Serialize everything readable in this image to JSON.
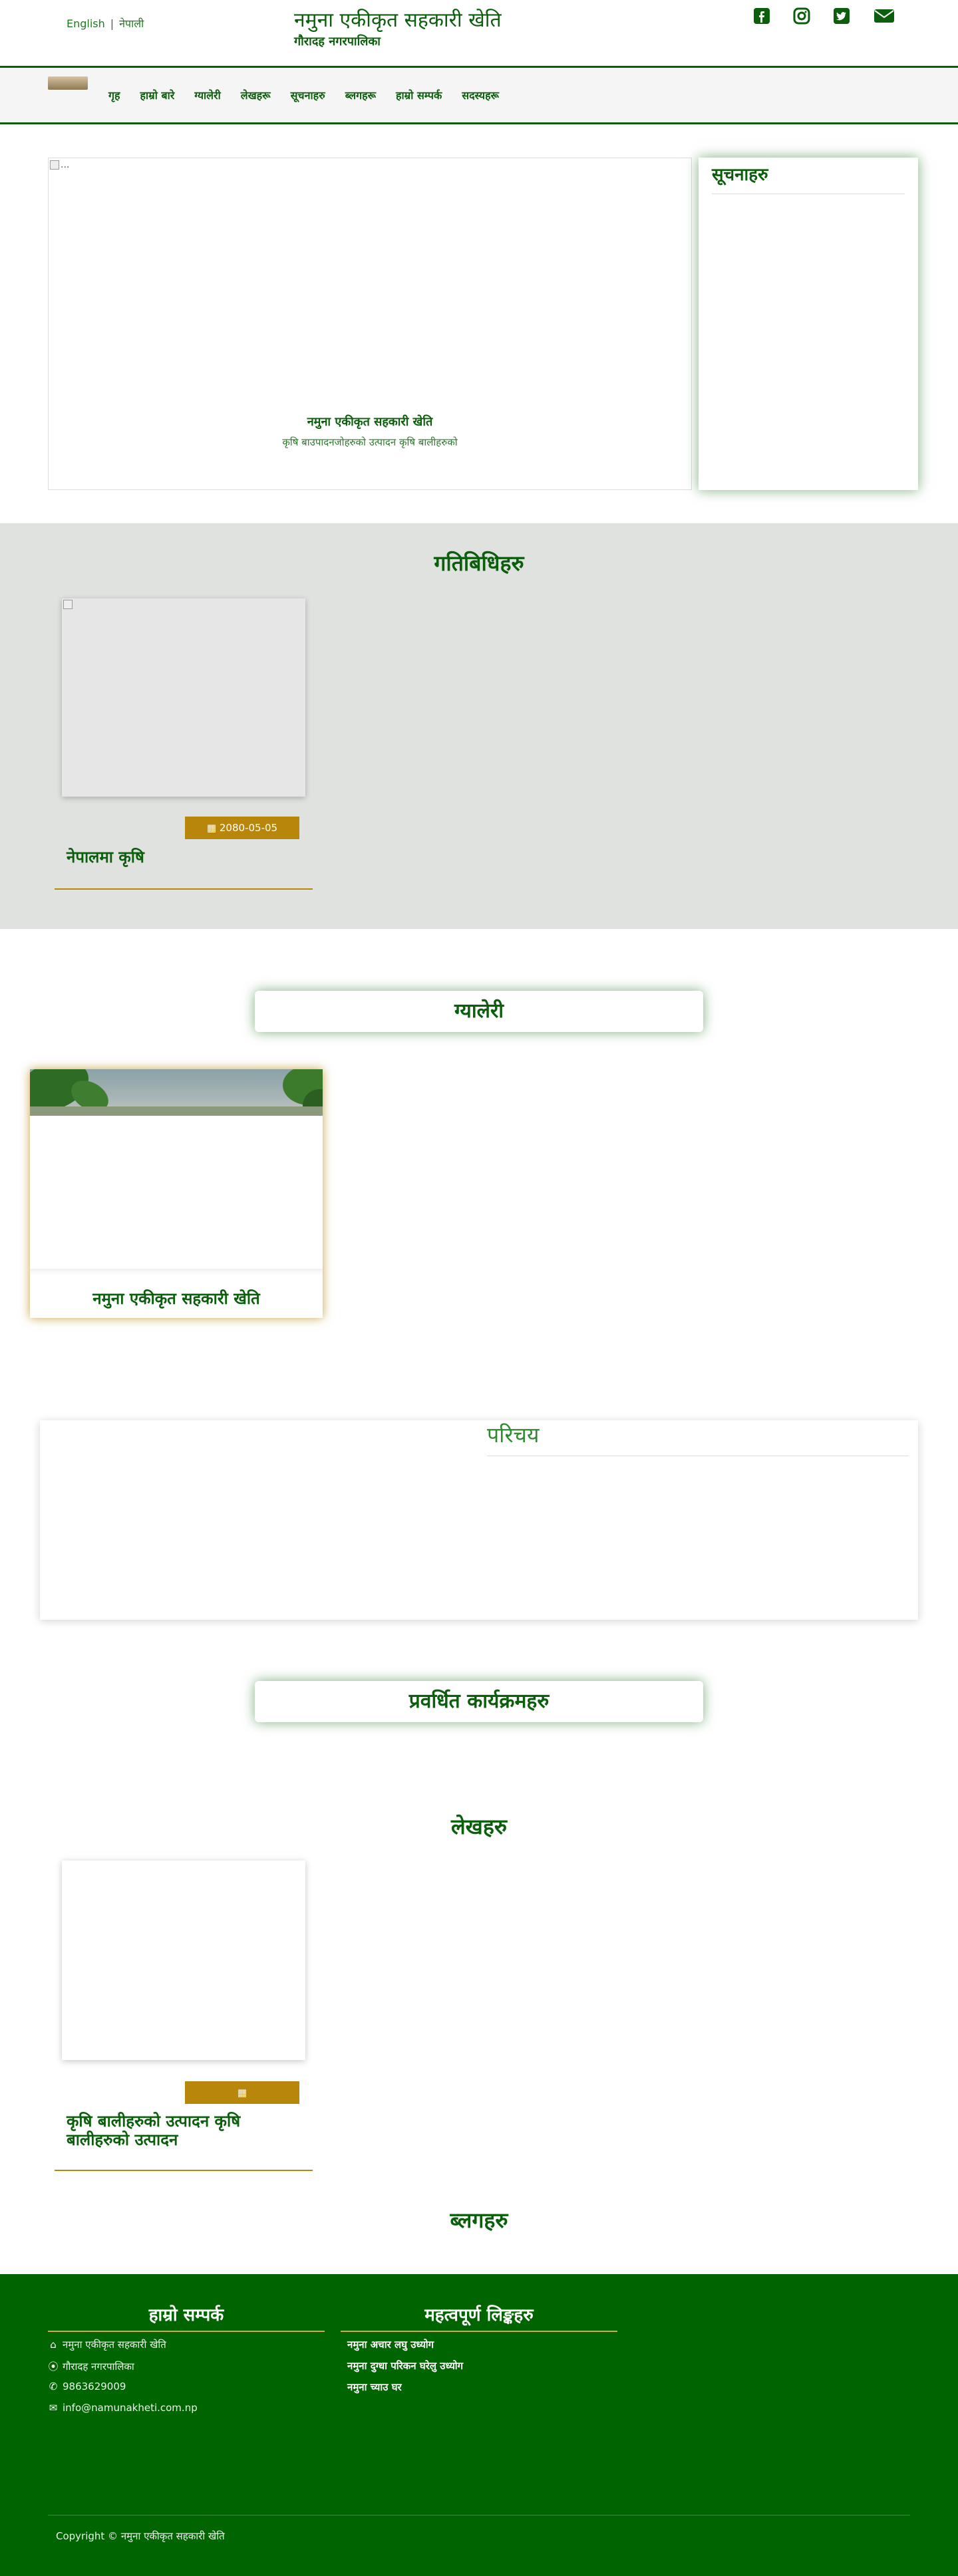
{
  "header": {
    "lang_en": "English",
    "lang_sep": "|",
    "lang_ne": "नेपाली",
    "title": "नमुना एकीकृत सहकारी खेति",
    "subtitle": "गौरादह नगरपालिका",
    "social_icons": [
      "facebook-square-icon",
      "instagram-icon",
      "twitter-square-icon",
      "envelope-icon"
    ]
  },
  "nav": {
    "items": [
      "गृह",
      "हाम्रो बारे",
      "ग्यालेरी",
      "लेखहरू",
      "सूचनाहरु",
      "ब्लगहरू",
      "हाम्रो सम्पर्क",
      "सदस्यहरू"
    ]
  },
  "hero": {
    "alt_text": "...",
    "caption_title": "नमुना एकीकृत सहकारी खेति",
    "caption_text": "कृषि बाउपादनजोहरुको उत्पादन कृषि बालीहरुको"
  },
  "notices": {
    "title": "सूचनाहरु"
  },
  "activities": {
    "title": "गतिबिधिहरु",
    "cards": [
      {
        "date": "2080-05-05",
        "heading": "नेपालमा कृषि",
        "date_icon": "calendar-icon"
      }
    ]
  },
  "gallery": {
    "title": "ग्यालेरी",
    "cards": [
      {
        "caption": "नमुना एकीकृत सहकारी खेति"
      }
    ]
  },
  "intro": {
    "title": "परिचय"
  },
  "programs": {
    "title": "प्रवर्धित कार्यक्रमहरु"
  },
  "articles": {
    "title": "लेखहरु",
    "cards": [
      {
        "date": "",
        "heading_line1": "कृषि बालीहरुको उत्पादन कृषि",
        "heading_line2": "बालीहरुको उत्पादन",
        "date_icon": "calendar-icon"
      }
    ]
  },
  "blogs": {
    "title": "ब्लगहरु"
  },
  "footer": {
    "contact_title": "हाम्रो सम्पर्क",
    "links_title": "महत्वपूर्ण लिङ्कहरु",
    "contact": {
      "name": "नमुना एकीकृत सहकारी खेति",
      "address": "गौरादह नगरपालिका",
      "phone": "9863629009",
      "email": "info@namunakheti.com.np"
    },
    "links": [
      "नमुना अचार लघु उध्योग",
      "नमुना दुग्धा परिकन घरेलु उध्योग",
      "नमुना च्याउ घर"
    ],
    "copyright": "Copyright © नमुना एकीकृत सहकारी खेति"
  },
  "colors": {
    "primary_green": "#0b5e0b",
    "footer_green": "#006400",
    "gold": "#b8860b",
    "section_gray": "#e0e2e0"
  }
}
